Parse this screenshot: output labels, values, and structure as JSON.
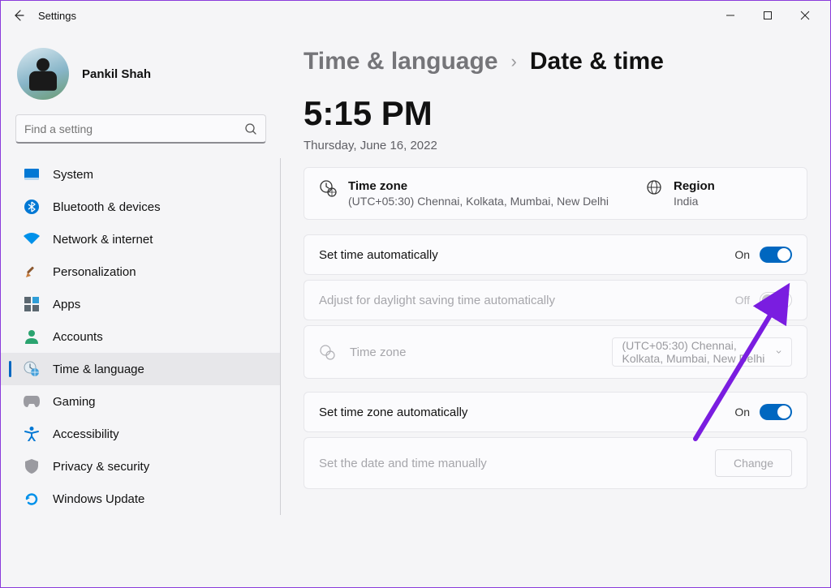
{
  "window": {
    "title": "Settings"
  },
  "profile": {
    "name": "Pankil Shah"
  },
  "search": {
    "placeholder": "Find a setting"
  },
  "sidebar": {
    "items": [
      {
        "label": "System"
      },
      {
        "label": "Bluetooth & devices"
      },
      {
        "label": "Network & internet"
      },
      {
        "label": "Personalization"
      },
      {
        "label": "Apps"
      },
      {
        "label": "Accounts"
      },
      {
        "label": "Time & language"
      },
      {
        "label": "Gaming"
      },
      {
        "label": "Accessibility"
      },
      {
        "label": "Privacy & security"
      },
      {
        "label": "Windows Update"
      }
    ]
  },
  "breadcrumb": {
    "parent": "Time & language",
    "current": "Date & time"
  },
  "clock": {
    "time": "5:15 PM",
    "date": "Thursday, June 16, 2022"
  },
  "summary": {
    "timezone_title": "Time zone",
    "timezone_value": "(UTC+05:30) Chennai, Kolkata, Mumbai, New Delhi",
    "region_title": "Region",
    "region_value": "India"
  },
  "settings": {
    "set_time_auto": {
      "label": "Set time automatically",
      "state": "On"
    },
    "dst_auto": {
      "label": "Adjust for daylight saving time automatically",
      "state": "Off"
    },
    "timezone_label": "Time zone",
    "timezone_select": "(UTC+05:30) Chennai, Kolkata, Mumbai, New Delhi",
    "set_tz_auto": {
      "label": "Set time zone automatically",
      "state": "On"
    },
    "set_manual": {
      "label": "Set the date and time manually",
      "button": "Change"
    }
  }
}
